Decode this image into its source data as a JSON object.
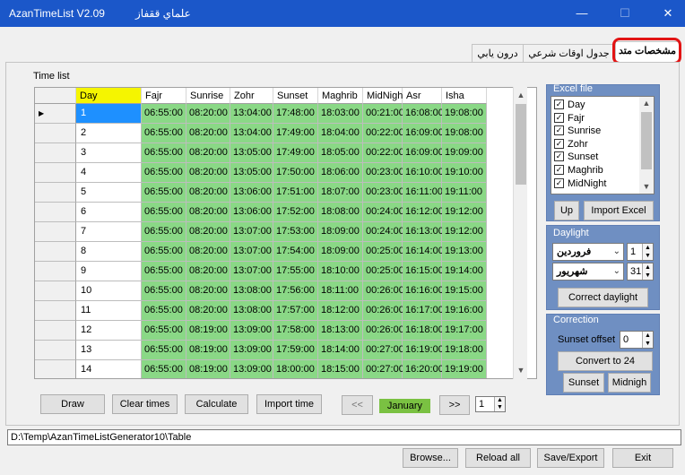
{
  "window": {
    "title": "AzanTimeList V2.09",
    "subtitle": "علماي ققفاز",
    "minimize": "—",
    "maximize": "☐",
    "close": "✕"
  },
  "tabs": [
    {
      "label": "مشخصات متد",
      "active": true
    },
    {
      "label": "جدول اوقات شرعي",
      "active": false
    },
    {
      "label": "درون يابي",
      "active": false
    }
  ],
  "time_list": {
    "label": "Time list",
    "columns": [
      "Day",
      "Fajr",
      "Sunrise",
      "Zohr",
      "Sunset",
      "Maghrib",
      "MidNight",
      "Asr",
      "Isha"
    ],
    "rows": [
      [
        "1",
        "06:55:00",
        "08:20:00",
        "13:04:00",
        "17:48:00",
        "18:03:00",
        "00:21:00",
        "16:08:00",
        "19:08:00"
      ],
      [
        "2",
        "06:55:00",
        "08:20:00",
        "13:04:00",
        "17:49:00",
        "18:04:00",
        "00:22:00",
        "16:09:00",
        "19:08:00"
      ],
      [
        "3",
        "06:55:00",
        "08:20:00",
        "13:05:00",
        "17:49:00",
        "18:05:00",
        "00:22:00",
        "16:09:00",
        "19:09:00"
      ],
      [
        "4",
        "06:55:00",
        "08:20:00",
        "13:05:00",
        "17:50:00",
        "18:06:00",
        "00:23:00",
        "16:10:00",
        "19:10:00"
      ],
      [
        "5",
        "06:55:00",
        "08:20:00",
        "13:06:00",
        "17:51:00",
        "18:07:00",
        "00:23:00",
        "16:11:00",
        "19:11:00"
      ],
      [
        "6",
        "06:55:00",
        "08:20:00",
        "13:06:00",
        "17:52:00",
        "18:08:00",
        "00:24:00",
        "16:12:00",
        "19:12:00"
      ],
      [
        "7",
        "06:55:00",
        "08:20:00",
        "13:07:00",
        "17:53:00",
        "18:09:00",
        "00:24:00",
        "16:13:00",
        "19:12:00"
      ],
      [
        "8",
        "06:55:00",
        "08:20:00",
        "13:07:00",
        "17:54:00",
        "18:09:00",
        "00:25:00",
        "16:14:00",
        "19:13:00"
      ],
      [
        "9",
        "06:55:00",
        "08:20:00",
        "13:07:00",
        "17:55:00",
        "18:10:00",
        "00:25:00",
        "16:15:00",
        "19:14:00"
      ],
      [
        "10",
        "06:55:00",
        "08:20:00",
        "13:08:00",
        "17:56:00",
        "18:11:00",
        "00:26:00",
        "16:16:00",
        "19:15:00"
      ],
      [
        "11",
        "06:55:00",
        "08:20:00",
        "13:08:00",
        "17:57:00",
        "18:12:00",
        "00:26:00",
        "16:17:00",
        "19:16:00"
      ],
      [
        "12",
        "06:55:00",
        "08:19:00",
        "13:09:00",
        "17:58:00",
        "18:13:00",
        "00:26:00",
        "16:18:00",
        "19:17:00"
      ],
      [
        "13",
        "06:55:00",
        "08:19:00",
        "13:09:00",
        "17:59:00",
        "18:14:00",
        "00:27:00",
        "16:19:00",
        "19:18:00"
      ],
      [
        "14",
        "06:55:00",
        "08:19:00",
        "13:09:00",
        "18:00:00",
        "18:15:00",
        "00:27:00",
        "16:20:00",
        "19:19:00"
      ]
    ],
    "current_row_marker": "▶"
  },
  "excel": {
    "title": "Excel file",
    "items": [
      "Day",
      "Fajr",
      "Sunrise",
      "Zohr",
      "Sunset",
      "Maghrib",
      "MidNight"
    ],
    "up_label": "Up",
    "import_label": "Import Excel"
  },
  "daylight": {
    "title": "Daylight",
    "start_month": "فروردين",
    "start_day": "1",
    "end_month": "شهريور",
    "end_day": "31",
    "correct_label": "Correct daylight"
  },
  "correction": {
    "title": "Correction",
    "sunset_offset_label": "Sunset offset",
    "sunset_offset_value": "0",
    "convert_label": "Convert to 24",
    "sunset_label": "Sunset",
    "midnight_label": "Midnigh"
  },
  "bottom_controls": {
    "draw": "Draw",
    "clear": "Clear times",
    "calculate": "Calculate",
    "import_time": "Import time",
    "prev": "<<",
    "month": "January",
    "next": ">>",
    "page": "1"
  },
  "path": "D:\\Temp\\AzanTimeListGenerator10\\Table",
  "footer": {
    "browse": "Browse...",
    "reload": "Reload all",
    "save": "Save/Export",
    "exit": "Exit"
  },
  "colors": {
    "titlebar": "#1b57c9",
    "time_cell": "#8ad886",
    "day_header": "#f5f500",
    "selected": "#1e90ff",
    "group_panel": "#6f8fc2",
    "month_badge": "#7ac142",
    "highlight_ring": "#e21414"
  }
}
